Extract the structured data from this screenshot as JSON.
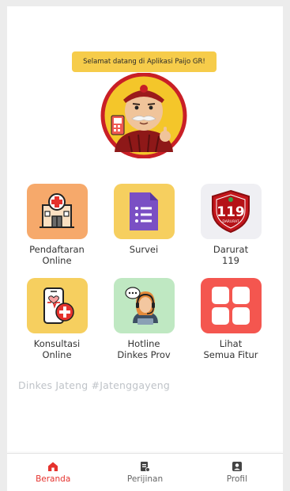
{
  "greeting": "Selamat datang di Aplikasi Paijo GR!",
  "features": [
    {
      "label": "Pendaftaran\nOnline",
      "icon": "hospital-icon",
      "tile_color": "#f6a96b"
    },
    {
      "label": "Survei",
      "icon": "survey-form-icon",
      "tile_color": "#f6cf5f"
    },
    {
      "label": "Darurat\n119",
      "icon": "emergency-119-shield-icon",
      "tile_color": "#efeff3"
    },
    {
      "label": "Konsultasi\nOnline",
      "icon": "phone-consultation-icon",
      "tile_color": "#f6cf5f"
    },
    {
      "label": "Hotline\nDinkes Prov",
      "icon": "customer-service-headset-icon",
      "tile_color": "#bfe8c2"
    },
    {
      "label": "Lihat\nSemua Fitur",
      "icon": "grid-icon",
      "tile_color": "#f4564f"
    }
  ],
  "badge_119": {
    "number": "119",
    "subtext": "DARURAT"
  },
  "slogan": "Dinkes Jateng #Jatenggayeng",
  "nav": [
    {
      "label": "Beranda",
      "icon": "home-icon",
      "active": true
    },
    {
      "label": "Perijinan",
      "icon": "document-icon",
      "active": false
    },
    {
      "label": "Profil",
      "icon": "profile-icon",
      "active": false
    }
  ],
  "colors": {
    "accent": "#e5322d",
    "greeting_bg": "#f6cc4a",
    "slogan": "#bfc3c8"
  }
}
